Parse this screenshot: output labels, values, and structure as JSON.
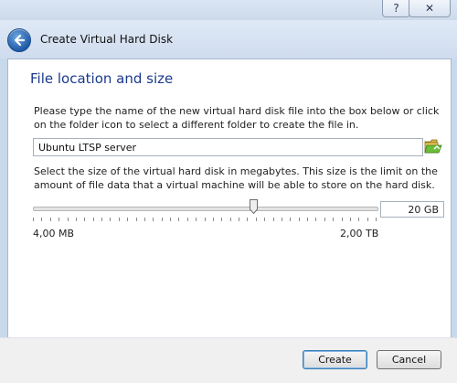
{
  "window": {
    "help_label": "?",
    "close_label": "✕",
    "title": "Create Virtual Hard Disk"
  },
  "page": {
    "heading": "File location and size",
    "location_text": "Please type the name of the new virtual hard disk file into the box below or click on the folder icon to select a different folder to create the file in.",
    "file_name": "Ubuntu LTSP server",
    "size_text": "Select the size of the virtual hard disk in megabytes. This size is the limit on the amount of file data that a virtual machine will be able to store on the hard disk.",
    "size_value": "20 GB",
    "slider_min_label": "4,00 MB",
    "slider_max_label": "2,00 TB",
    "slider_level_fraction": 0.64
  },
  "footer": {
    "create_label": "Create",
    "cancel_label": "Cancel"
  },
  "colors": {
    "heading": "#1b3a8c",
    "window_frame": "#c9d9ec",
    "accent_button_border": "#3c7fb1"
  },
  "icons": {
    "back": "back-arrow-icon",
    "folder": "folder-open-icon",
    "help": "help-icon",
    "close": "close-icon"
  }
}
